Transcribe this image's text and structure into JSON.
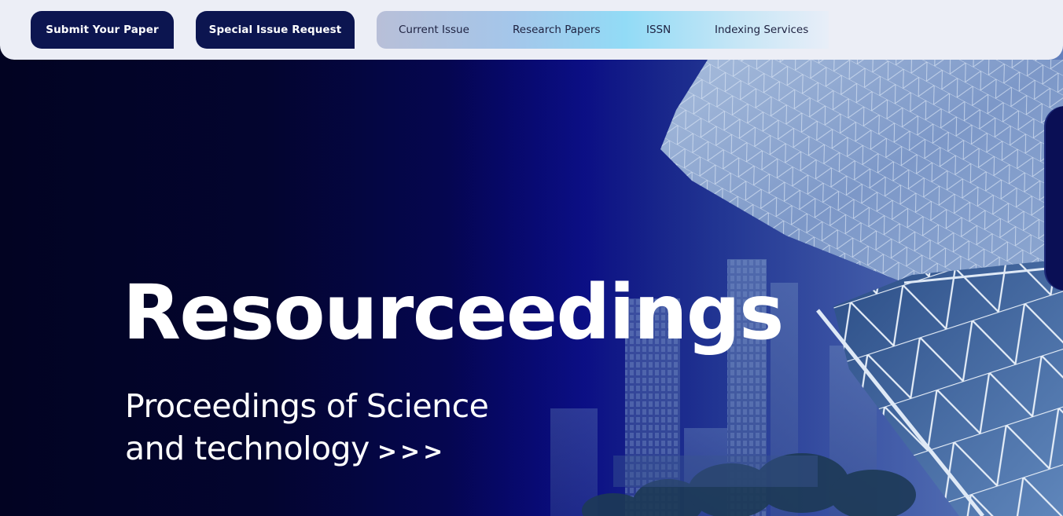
{
  "header": {
    "submit_label": "Submit Your Paper",
    "special_label": "Special Issue Request",
    "nav": [
      "Current Issue",
      "Research Papers",
      "ISSN",
      "Indexing Services"
    ]
  },
  "hero": {
    "title": "Resourceedings",
    "subtitle_line1": "Proceedings of Science",
    "subtitle_line2": "and technology",
    "arrows": ">>>"
  },
  "colors": {
    "navy": "#0c1550",
    "topbar_bg": "#eceef6",
    "hero_dark": "#020322",
    "hero_blue": "#07088a"
  }
}
